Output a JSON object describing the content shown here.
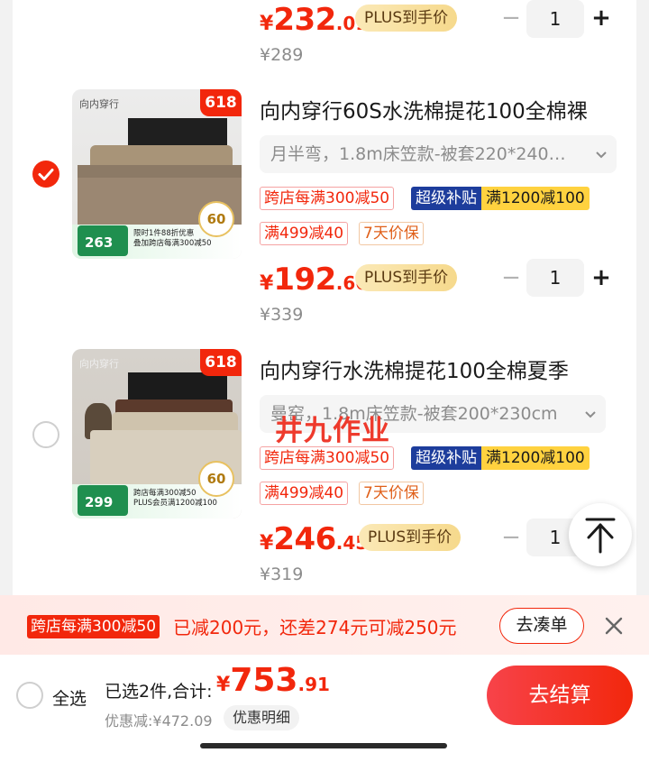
{
  "colors": {
    "accent": "#f2270c",
    "plus_gold": "#f6d98c",
    "subsidy_blue": "#1d3d9c",
    "subsidy_yellow": "#ffd23f"
  },
  "items": [
    {
      "price_currency": "¥",
      "price_int": "232",
      "price_dec": ".01",
      "plus_label": "PLUS到手价",
      "original_price": "¥289",
      "quantity": "1",
      "minus": "−",
      "plus": "+"
    },
    {
      "checked": true,
      "tag": "618",
      "brand": "向内穿行",
      "title": "向内穿行60S水洗棉提花100全棉裸",
      "spec": "月半弯，1.8m床笠款-被套220*240…",
      "promos": [
        "跨店每满300减50",
        "满499减40",
        "7天价保"
      ],
      "subsidy_a": "超级补贴",
      "subsidy_b": "满1200减100",
      "thumb_price": "263",
      "thumb_line1": "限时1件88折优惠",
      "thumb_line2": "叠加跨店每满300减50",
      "badge": "60",
      "price_currency": "¥",
      "price_int": "192",
      "price_dec": ".66",
      "plus_label": "PLUS到手价",
      "original_price": "¥339",
      "quantity": "1",
      "minus": "−",
      "plus": "+"
    },
    {
      "checked": false,
      "tag": "618",
      "brand": "向内穿行",
      "title": "向内穿行水洗棉提花100全棉夏季",
      "spec": "曼窑，1.8m床笠款-被套200*230cm",
      "promos": [
        "跨店每满300减50",
        "满499减40",
        "7天价保"
      ],
      "subsidy_a": "超级补贴",
      "subsidy_b": "满1200减100",
      "thumb_price": "299",
      "thumb_line1": "跨店每满300减50",
      "thumb_line2": "PLUS会员满1200减100",
      "badge": "60",
      "price_currency": "¥",
      "price_int": "246",
      "price_dec": ".45",
      "plus_label": "PLUS到手价",
      "original_price": "¥319",
      "quantity": "1",
      "minus": "−",
      "plus": "+"
    }
  ],
  "watermark": "井九作业",
  "back_to_top_icon": "arrow-up-to-top-icon",
  "discount_bar": {
    "label": "跨店每满300减50",
    "message": "已减200元，还差274元可减250元",
    "button": "去凑单",
    "close": "×"
  },
  "footer": {
    "select_all": "全选",
    "selected_text": "已选2件,合计:",
    "total_currency": "¥",
    "total_int": "753",
    "total_dec": ".91",
    "discount_text": "优惠减:¥472.09",
    "detail_button": "优惠明细",
    "checkout_button": "去结算"
  }
}
